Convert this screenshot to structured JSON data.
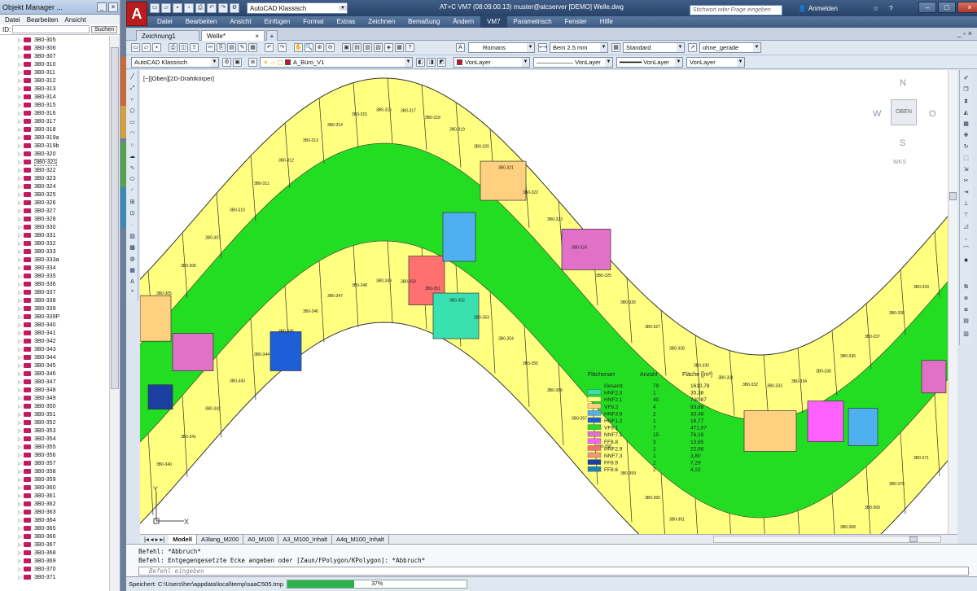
{
  "object_manager": {
    "title": "Objekt Manager ...",
    "menu": [
      "Datei",
      "Bearbeiten",
      "Ansicht"
    ],
    "search_label": "ID:",
    "search_button": "Suchen",
    "tree_items": [
      "3B0-305",
      "3B0-306",
      "3B0-307",
      "3B0-310",
      "3B0-311",
      "3B0-312",
      "3B0-313",
      "3B0-314",
      "3B0-315",
      "3B0-316",
      "3B0-317",
      "3B0-318",
      "3B0-319a",
      "3B0-319b",
      "3B0-320",
      "3B0-321",
      "3B0-322",
      "3B0-323",
      "3B0-324",
      "3B0-325",
      "3B0-326",
      "3B0-327",
      "3B0-328",
      "3B0-330",
      "3B0-331",
      "3B0-332",
      "3B0-333",
      "3B0-333a",
      "3B0-334",
      "3B0-335",
      "3B0-336",
      "3B0-337",
      "3B0-338",
      "3B0-339",
      "3B0-339P",
      "3B0-340",
      "3B0-341",
      "3B0-342",
      "3B0-343",
      "3B0-344",
      "3B0-345",
      "3B0-346",
      "3B0-347",
      "3B0-348",
      "3B0-349",
      "3B0-350",
      "3B0-351",
      "3B0-352",
      "3B0-353",
      "3B0-354",
      "3B0-355",
      "3B0-356",
      "3B0-357",
      "3B0-358",
      "3B0-359",
      "3B0-360",
      "3B0-361",
      "3B0-362",
      "3B0-363",
      "3B0-364",
      "3B0-365",
      "3B0-366",
      "3B0-367",
      "3B0-368",
      "3B0-369",
      "3B0-370",
      "3B0-371"
    ],
    "selected_item": "3B0-321",
    "folder_color": "#c8185e"
  },
  "app": {
    "logo": "A",
    "workspace": "AutoCAD Klassisch",
    "window_title": "AT+C VM7 (08.09.00.13)  muster@atcserver  [DEMO]  Welle.dwg",
    "help_search_placeholder": "Stichwort oder Frage eingeben",
    "login_label": "Anmelden",
    "menu": [
      "Datei",
      "Bearbeiten",
      "Ansicht",
      "Einfügen",
      "Format",
      "Extras",
      "Zeichnen",
      "Bemaßung",
      "Ändern",
      "VM7",
      "Parametrisch",
      "Fenster",
      "Hilfe"
    ],
    "active_menu": "VM7",
    "doc_tabs": [
      "Zeichnung1",
      "Welle*"
    ],
    "active_doc_tab": "Welle*"
  },
  "toolbar": {
    "text_style": "Romans",
    "dim_style": "Bem 2.5 mm",
    "table_style": "Standard",
    "multileader_style": "ohne_gerade",
    "workspace2": "AutoCAD Klassisch",
    "layer": "A_Büro_V1",
    "color": "VonLayer",
    "linetype": "VonLayer",
    "lineweight": "VonLayer",
    "plotstyle": "VonLayer"
  },
  "viewport": {
    "label": "[−][Oben][2D-Drahtkörper]",
    "viewcube": {
      "n": "N",
      "s": "S",
      "w": "W",
      "o": "O",
      "face": "OBEN",
      "ucs": "WKS"
    },
    "ucs_x": "X",
    "ucs_y": "Y"
  },
  "rooms": [
    "3B0-305",
    "3B0-306",
    "3B0-307",
    "3B0-310",
    "3B0-311",
    "3B0-312",
    "3B0-313",
    "3B0-314",
    "3B0-315",
    "3B0-316",
    "3B0-317",
    "3B0-318",
    "3B0-319",
    "3B0-320",
    "3B0-321",
    "3B0-322",
    "3B0-323",
    "3B0-324",
    "3B0-325",
    "3B0-326",
    "3B0-327",
    "3B0-328",
    "3B0-330",
    "3B0-331",
    "3B0-332",
    "3B0-333",
    "3B0-334",
    "3B0-335",
    "3B0-336",
    "3B0-337",
    "3B0-338",
    "3B0-339",
    "3B0-340",
    "3B0-341",
    "3B0-342",
    "3B0-343",
    "3B0-344",
    "3B0-345",
    "3B0-346",
    "3B0-347",
    "3B0-348",
    "3B0-349",
    "3B0-350",
    "3B0-351",
    "3B0-352",
    "3B0-353",
    "3B0-354",
    "3B0-355",
    "3B0-356",
    "3B0-357",
    "3B0-358",
    "3B0-359",
    "3B0-360",
    "3B0-361",
    "3B0-362",
    "3B0-363",
    "3B0-364",
    "3B0-365",
    "3B0-366",
    "3B0-367",
    "3B0-368",
    "3B0-369",
    "3B0-370",
    "3B0-371"
  ],
  "legend": {
    "headers": [
      "Flächenart",
      "Anzahl",
      "Fläche [[m²]"
    ],
    "rows": [
      {
        "label": "Gesamt",
        "count": "79",
        "area": "1610,78",
        "color": ""
      },
      {
        "label": "HNF2.3",
        "count": "1",
        "area": "35,38",
        "color": "#39e0b0"
      },
      {
        "label": "HNF2.1",
        "count": "40",
        "area": "740,87",
        "color": "#ffff80"
      },
      {
        "label": "VF9.2",
        "count": "4",
        "area": "83,88",
        "color": "#ffd080"
      },
      {
        "label": "HNF3.9",
        "count": "2",
        "area": "33,48",
        "color": "#4fb0f0"
      },
      {
        "label": "HNF1.2",
        "count": "1",
        "area": "16,77",
        "color": "#1e5fd8"
      },
      {
        "label": "VF9.1",
        "count": "7",
        "area": "471,07",
        "color": "#22dd22"
      },
      {
        "label": "NNF7.1",
        "count": "15",
        "area": "76,18",
        "color": "#e070c8"
      },
      {
        "label": "FF8.8",
        "count": "3",
        "area": "13,65",
        "color": "#ff60ff"
      },
      {
        "label": "HNF2.9",
        "count": "1",
        "area": "22,98",
        "color": "#ff7070"
      },
      {
        "label": "NNF7.3",
        "count": "1",
        "area": "3,80",
        "color": "#f09870"
      },
      {
        "label": "FF8.9",
        "count": "2",
        "area": "7,29",
        "color": "#1b3fa0"
      },
      {
        "label": "FF8.6",
        "count": "2",
        "area": "4,22",
        "color": "#1880c0"
      }
    ]
  },
  "layout_tabs": [
    "Modell",
    "A3lang_M200",
    "A0_M100",
    "A3_M100_Inhalt",
    "A4q_M100_Inhalt"
  ],
  "active_layout": "Modell",
  "command": {
    "lines": [
      "Befehl: *Abbruch*",
      "Befehl: Entgegengesetzte Ecke angeben oder [Zaun/FPolygon/KPolygon]: *Abbruch*"
    ],
    "placeholder": "Befehl eingeben"
  },
  "status": {
    "saving_text": "Speichert: C:\\Users\\her\\appdata\\local\\temp\\saaC505.tmp",
    "progress_label": "37%",
    "progress": 0.37
  }
}
